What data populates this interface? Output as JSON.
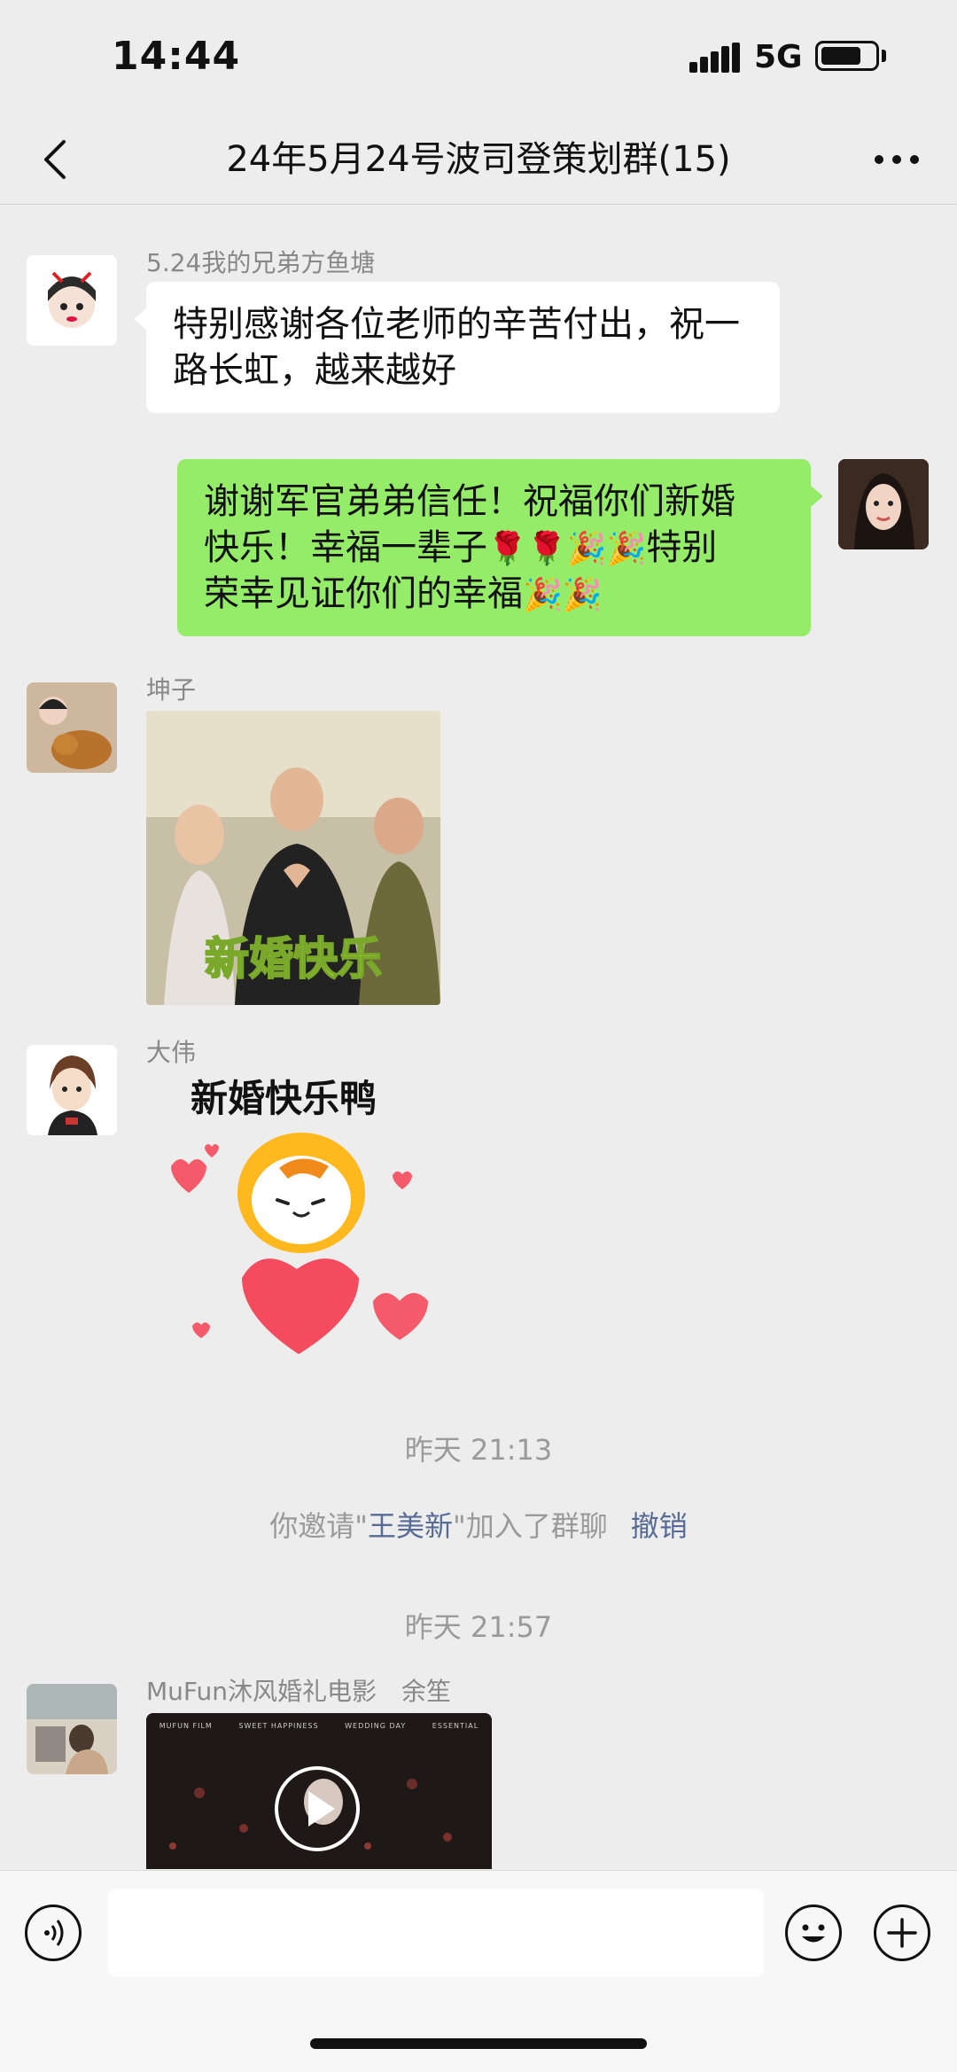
{
  "status_bar": {
    "time": "14:44",
    "network": "5G",
    "battery_level": 0.7
  },
  "nav": {
    "title": "24年5月24号波司登策划群(15)"
  },
  "messages": [
    {
      "sender": "5.24我的兄弟方鱼塘",
      "text": "特别感谢各位老师的辛苦付出，祝一路长虹，越来越好"
    },
    {
      "line1": "谢谢军官弟弟信任！祝福你们新婚",
      "line2_text": "快乐！幸福一辈子",
      "line3_text": "荣幸见证你们的幸福",
      "tail": "特别",
      "icons": [
        "rose-emoji",
        "party-popper-emoji"
      ]
    },
    {
      "sender": "坤子",
      "image_caption": "新婚快乐"
    },
    {
      "sender": "大伟",
      "sticker_text": "新婚快乐鸭"
    }
  ],
  "system": {
    "time1": "昨天 21:13",
    "invite_prefix": "你邀请\"",
    "invite_name": "王美新",
    "invite_suffix": "\"加入了群聊",
    "revoke": "撤销",
    "time2": "昨天 21:57"
  },
  "video_message": {
    "sender": "MuFun沐风婚礼电影　余笙",
    "header_texts": [
      "MUFUN FILM",
      "SWEET HAPPINESS",
      "WEDDING DAY",
      "ESSENTIAL"
    ]
  },
  "input": {
    "placeholder": ""
  },
  "colors": {
    "accent_green": "#95ec69",
    "link_blue": "#576b95",
    "background": "#ededed"
  }
}
